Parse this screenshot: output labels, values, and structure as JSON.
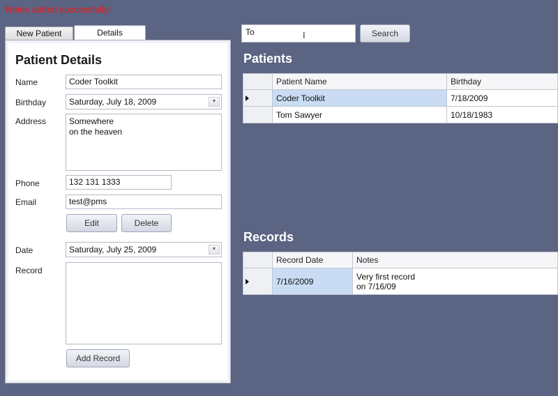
{
  "status_message": "Notes added successfully!",
  "tabs": [
    {
      "label": "New Patient",
      "active": false
    },
    {
      "label": "Details",
      "active": true
    }
  ],
  "patient_details": {
    "title": "Patient Details",
    "name_label": "Name",
    "name_value": "Coder Toolkit",
    "birthday_label": "Birthday",
    "birthday_value": "Saturday, July 18, 2009",
    "address_label": "Address",
    "address_value": "Somewhere\non the heaven",
    "phone_label": "Phone",
    "phone_value": "132 131 1333",
    "email_label": "Email",
    "email_value": "test@pms",
    "edit_label": "Edit",
    "delete_label": "Delete",
    "date_label": "Date",
    "date_value": "Saturday, July 25, 2009",
    "record_label": "Record",
    "record_value": "",
    "add_record_label": "Add Record"
  },
  "search": {
    "value": "To",
    "button_label": "Search"
  },
  "patients": {
    "title": "Patients",
    "columns": [
      "Patient Name",
      "Birthday"
    ],
    "rows": [
      {
        "name": "Coder Toolkit",
        "birthday": "7/18/2009",
        "selected": true
      },
      {
        "name": "Tom Sawyer",
        "birthday": "10/18/1983",
        "selected": false
      }
    ]
  },
  "records": {
    "title": "Records",
    "columns": [
      "Record Date",
      "Notes"
    ],
    "rows": [
      {
        "date": "7/16/2009",
        "notes": "Very first record\non 7/16/09",
        "selected": true
      }
    ]
  },
  "colors": {
    "background": "#5c6483",
    "status_text": "#e81818",
    "selection": "#c9dcf3"
  }
}
